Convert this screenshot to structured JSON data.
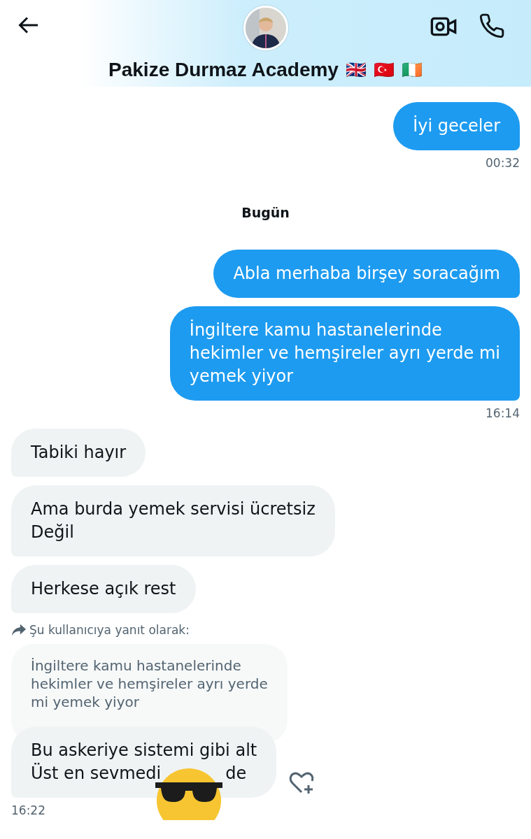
{
  "header": {
    "name": "Pakize Durmaz Academy",
    "flags": [
      "🇬🇧",
      "🇹🇷",
      "🇮🇪"
    ]
  },
  "messages": [
    {
      "kind": "sent",
      "lines": [
        "İyi geceler"
      ]
    },
    {
      "kind": "sent_time",
      "text": "00:32"
    },
    {
      "kind": "date",
      "text": "Bugün"
    },
    {
      "kind": "sent",
      "lines": [
        "Abla merhaba birşey soracağım"
      ]
    },
    {
      "kind": "sent",
      "lines": [
        "İngiltere kamu hastanelerinde",
        "hekimler ve hemşireler ayrı yerde mi",
        "yemek yiyor"
      ]
    },
    {
      "kind": "sent_time",
      "text": "16:14"
    },
    {
      "kind": "received",
      "lines": [
        "Tabiki hayır"
      ]
    },
    {
      "kind": "received",
      "lines": [
        "Ama burda yemek servisi ücretsiz",
        "Değil"
      ]
    },
    {
      "kind": "received",
      "lines": [
        "Herkese açık rest"
      ]
    },
    {
      "kind": "reply",
      "label": "Şu kullanıcıya yanıt olarak:",
      "quote": [
        "İngiltere kamu hastanelerinde",
        "hekimler ve hemşireler ayrı yerde",
        "mi yemek yiyor"
      ],
      "lines": [
        "Bu askeriye sistemi gibi alt"
      ],
      "covered_line": [
        "Üst en sevmedi",
        "de"
      ]
    },
    {
      "kind": "received_time",
      "text": "16:22"
    }
  ]
}
